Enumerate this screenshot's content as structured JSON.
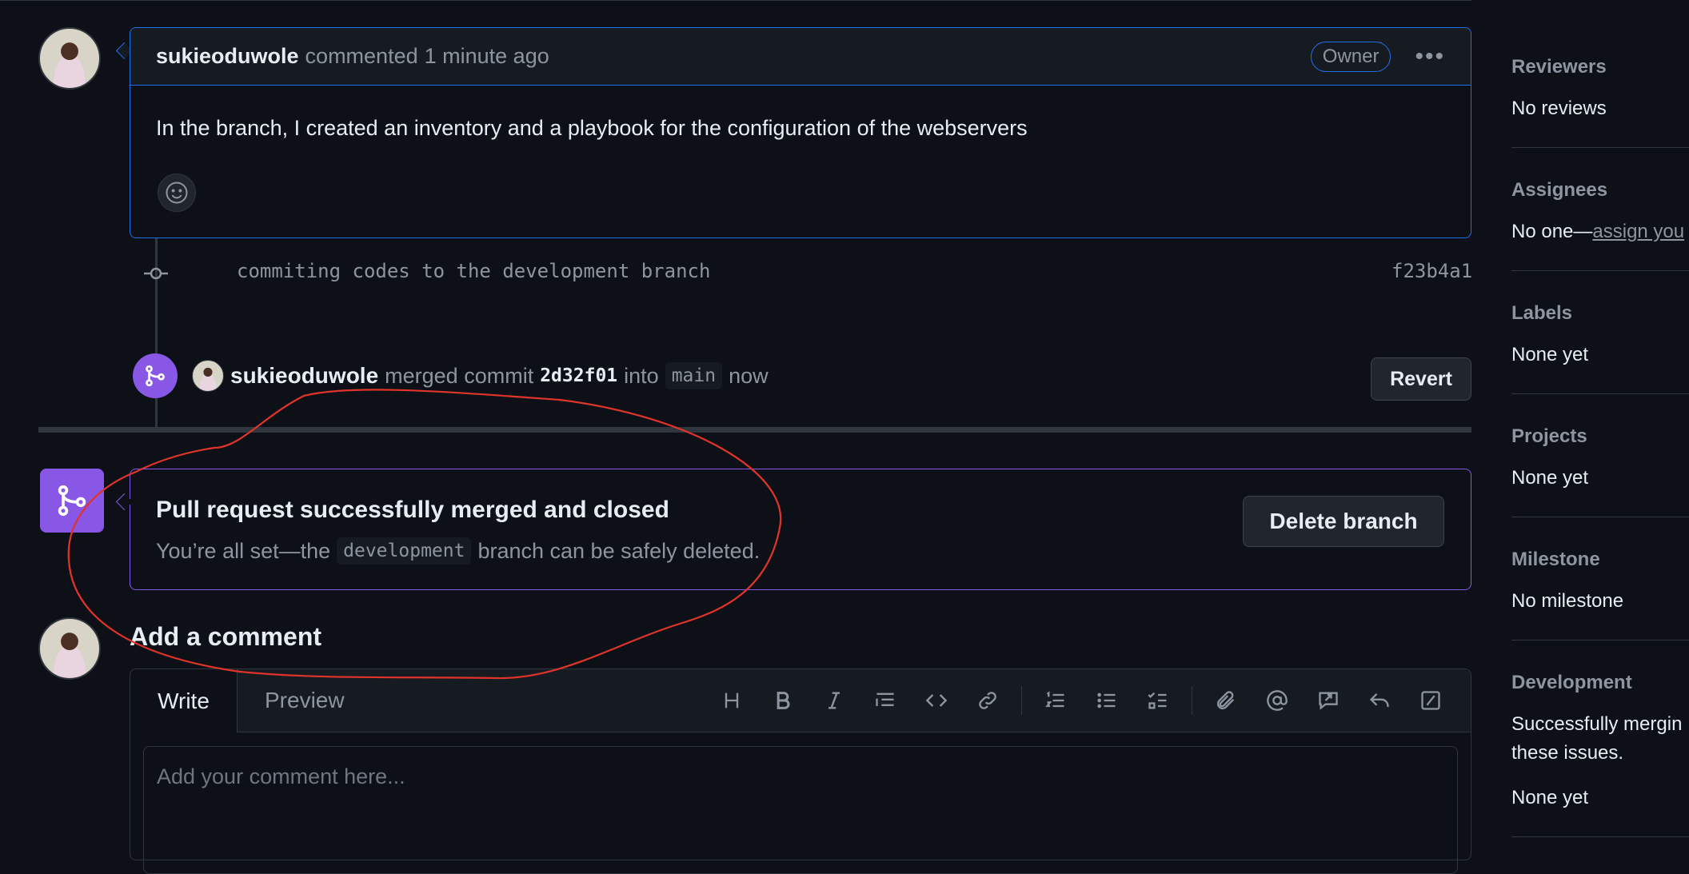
{
  "comment": {
    "author": "sukieoduwole",
    "action": "commented",
    "time": "1 minute ago",
    "badge": "Owner",
    "menu_icon": "kebab-horizontal-icon",
    "body": "In the branch, I created an inventory and a playbook for the configuration of the webservers",
    "reaction_icon": "smiley-icon"
  },
  "commit": {
    "message": "commiting codes to the development branch",
    "sha": "f23b4a1"
  },
  "merge_event": {
    "author": "sukieoduwole",
    "text1": "merged commit",
    "commit": "2d32f01",
    "text2": "into",
    "branch": "main",
    "time": "now",
    "revert_label": "Revert"
  },
  "merged_box": {
    "title": "Pull request successfully merged and closed",
    "sub_prefix": "You’re all set—the",
    "branch": "development",
    "sub_suffix": "branch can be safely deleted.",
    "delete_label": "Delete branch"
  },
  "add_comment": {
    "title": "Add a comment",
    "tab_write": "Write",
    "tab_preview": "Preview",
    "placeholder": "Add your comment here...",
    "toolbar_icons": [
      "heading-icon",
      "bold-icon",
      "italic-icon",
      "quote-icon",
      "code-icon",
      "link-icon",
      "ordered-list-icon",
      "unordered-list-icon",
      "task-list-icon",
      "attach-icon",
      "mention-icon",
      "reference-icon",
      "reply-icon",
      "slash-command-icon"
    ]
  },
  "sidebar": {
    "reviewers": {
      "label": "Reviewers",
      "value": "No reviews"
    },
    "assignees": {
      "label": "Assignees",
      "value_prefix": "No one—",
      "value_link": "assign you"
    },
    "labels": {
      "label": "Labels",
      "value": "None yet"
    },
    "projects": {
      "label": "Projects",
      "value": "None yet"
    },
    "milestone": {
      "label": "Milestone",
      "value": "No milestone"
    },
    "development": {
      "label": "Development",
      "value_line1": "Successfully mergin",
      "value_line2": "these issues.",
      "value": "None yet"
    }
  },
  "colors": {
    "accent_blue": "#1f6feb",
    "merged_purple": "#8957e5",
    "background": "#0d1117",
    "annotation_red": "#e0342b"
  }
}
